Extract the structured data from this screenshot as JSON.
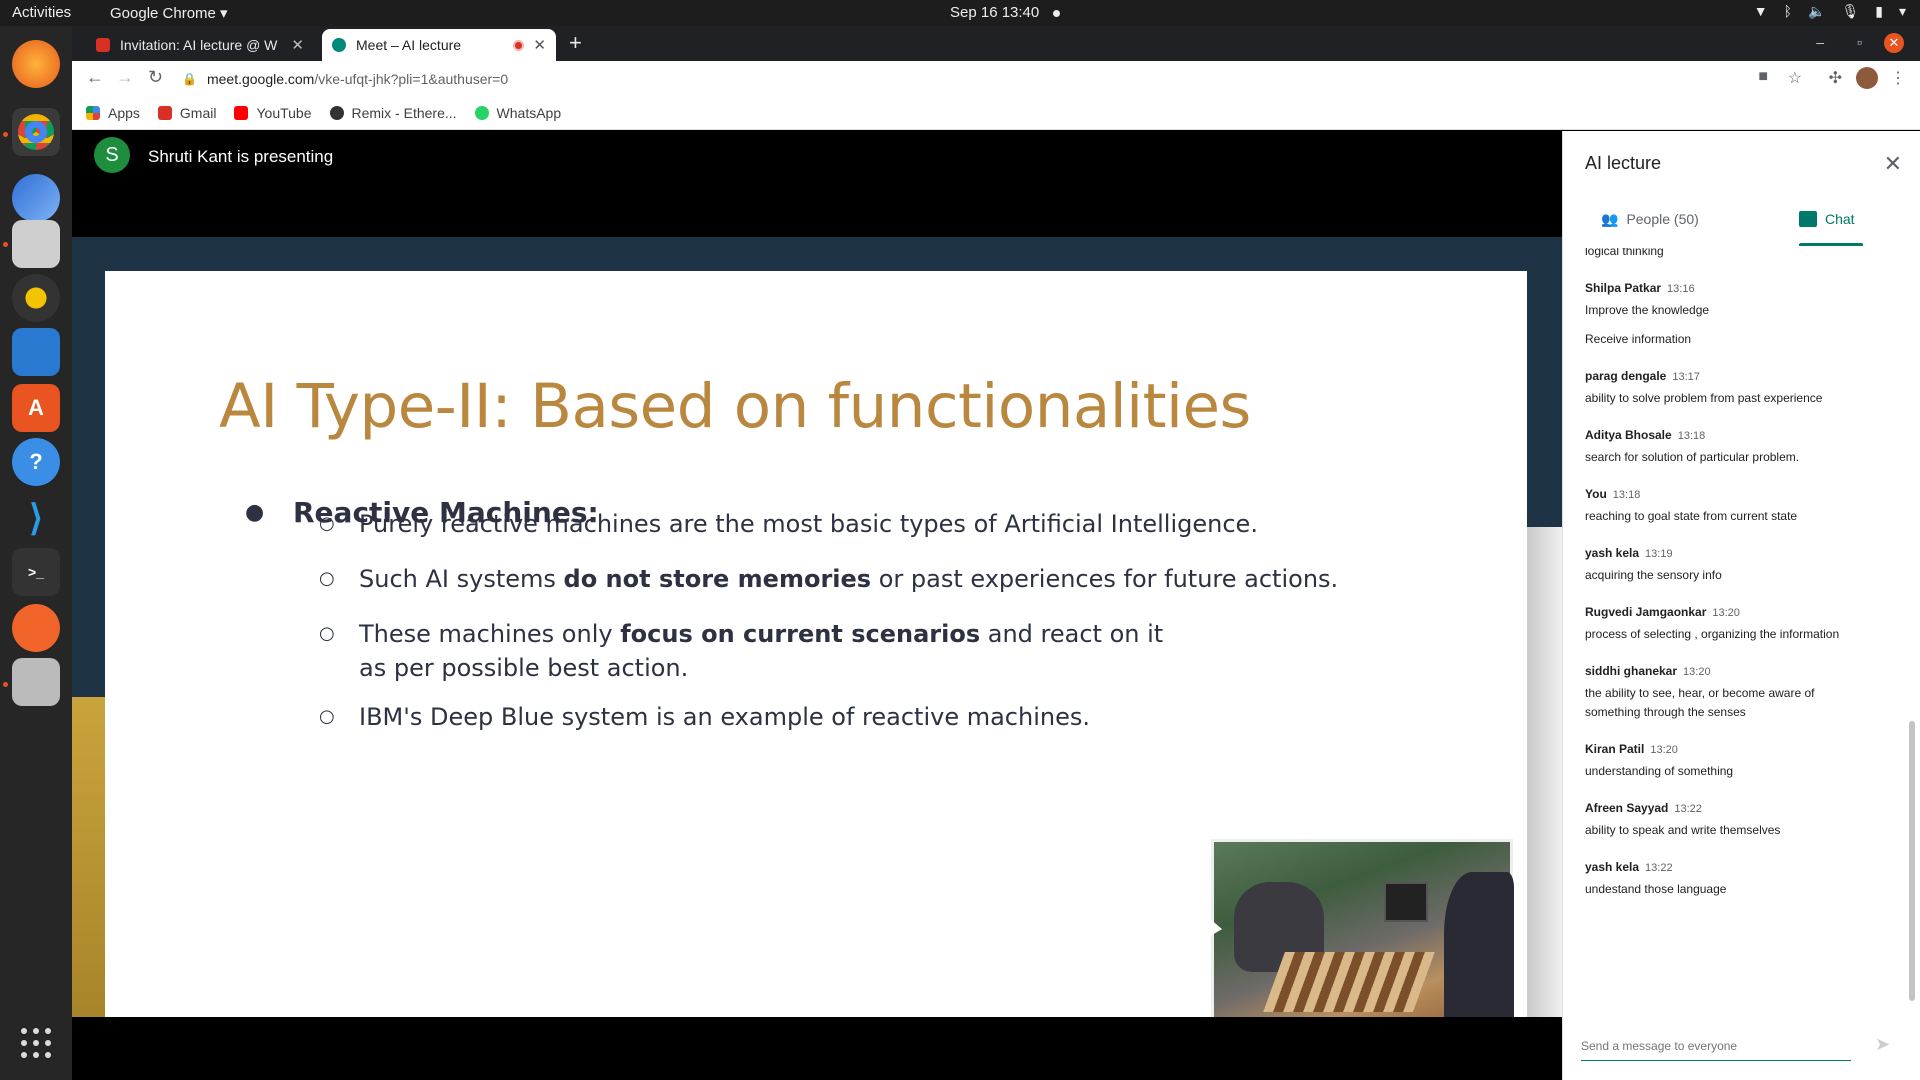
{
  "os": {
    "activities": "Activities",
    "app_menu": "Google Chrome ▾",
    "clock": "Sep 16  13:40"
  },
  "browser": {
    "tabs": [
      {
        "title": "Invitation: AI lecture @ W"
      },
      {
        "title": "Meet – AI lecture"
      }
    ],
    "url_host": "meet.google.com",
    "url_path": "/vke-ufqt-jhk?pli=1&authuser=0",
    "bookmarks": [
      "Apps",
      "Gmail",
      "YouTube",
      "Remix - Ethere...",
      "WhatsApp"
    ]
  },
  "meet": {
    "presenter_initial": "S",
    "presenter_text": "Shruti Kant is presenting"
  },
  "slide": {
    "title": "AI Type-II: Based on functionalities",
    "heading": "Reactive Machines:",
    "bullets": [
      {
        "pre": "Purely reactive machines are the most basic types of Artificial Intelligence.",
        "bold": "",
        "post": ""
      },
      {
        "pre": "Such AI systems ",
        "bold": "do not store memories",
        "post": " or past experiences for future actions."
      },
      {
        "pre": "These machines only ",
        "bold": "focus on current scenarios",
        "post": " and react on it as per possible best action."
      },
      {
        "pre": "IBM's Deep Blue system is an example of reactive machines.",
        "bold": "",
        "post": ""
      }
    ]
  },
  "panel": {
    "title": "AI lecture",
    "people_tab": "People (50)",
    "chat_tab": "Chat",
    "composer_placeholder": "Send a message to everyone",
    "messages": [
      {
        "author": "",
        "time": "",
        "lines": [
          "logical thinking"
        ]
      },
      {
        "author": "Shilpa Patkar",
        "time": "13:16",
        "lines": [
          "Improve the knowledge",
          "",
          "Receive information"
        ]
      },
      {
        "author": "parag dengale",
        "time": "13:17",
        "lines": [
          "ability to solve problem from past experience"
        ]
      },
      {
        "author": "Aditya Bhosale",
        "time": "13:18",
        "lines": [
          "search for solution of particular problem."
        ]
      },
      {
        "author": "You",
        "time": "13:18",
        "lines": [
          "reaching to goal state from current state"
        ]
      },
      {
        "author": "yash kela",
        "time": "13:19",
        "lines": [
          "acquiring the sensory info"
        ]
      },
      {
        "author": "Rugvedi Jamgaonkar",
        "time": "13:20",
        "lines": [
          "process of selecting , organizing the information"
        ]
      },
      {
        "author": "siddhi ghanekar",
        "time": "13:20",
        "lines": [
          "the ability to see, hear, or become aware of",
          "something through the senses"
        ]
      },
      {
        "author": "Kiran Patil",
        "time": "13:20",
        "lines": [
          "understanding of something"
        ]
      },
      {
        "author": "Afreen Sayyad",
        "time": "13:22",
        "lines": [
          "ability to speak and write themselves"
        ]
      },
      {
        "author": "yash kela",
        "time": "13:22",
        "lines": [
          "undestand those language"
        ]
      }
    ]
  },
  "colors": {
    "slide_title": "#b9873e",
    "meet_accent": "#00796b",
    "presenter_avatar": "#1e8e3e"
  }
}
